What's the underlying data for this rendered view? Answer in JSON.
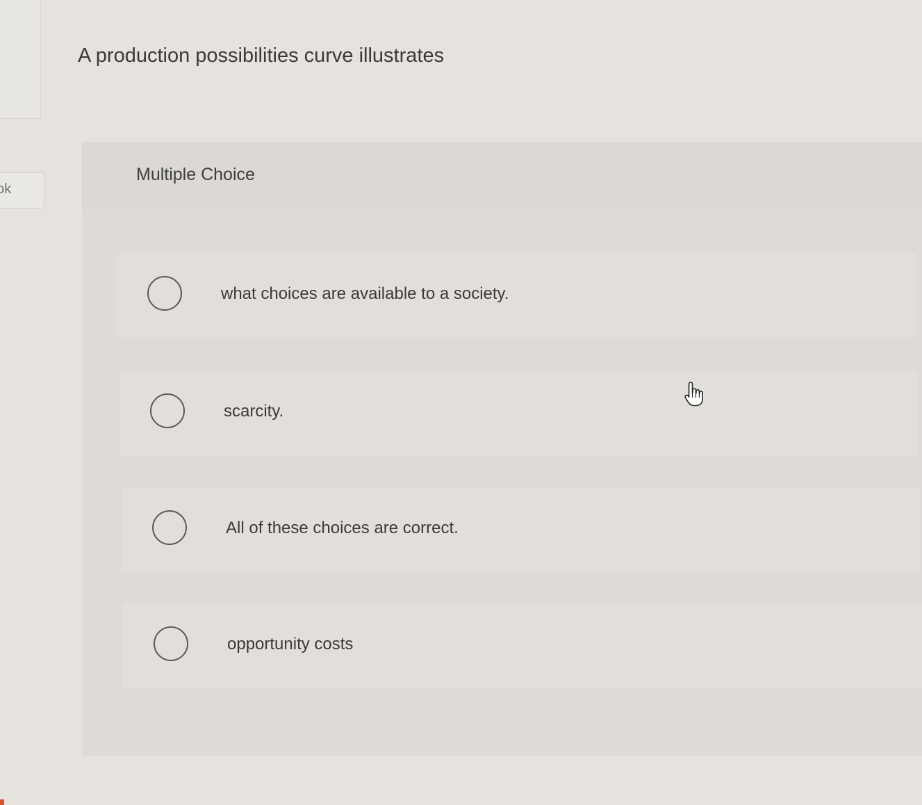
{
  "sidebar": {
    "tab_label": "ok"
  },
  "question": {
    "text": "A production possibilities curve illustrates"
  },
  "panel": {
    "title": "Multiple Choice"
  },
  "choices": [
    {
      "label": "what choices are available to a society."
    },
    {
      "label": "scarcity."
    },
    {
      "label": "All of these choices are correct."
    },
    {
      "label": "opportunity costs"
    }
  ],
  "colors": {
    "background": "#e6e3de",
    "panel": "#dedbd6",
    "choice": "#e2dfda",
    "radio_border": "#595959",
    "accent": "#d9532b"
  },
  "icons": {
    "cursor": "hand-pointer-icon",
    "radio": "radio-button-unselected"
  }
}
